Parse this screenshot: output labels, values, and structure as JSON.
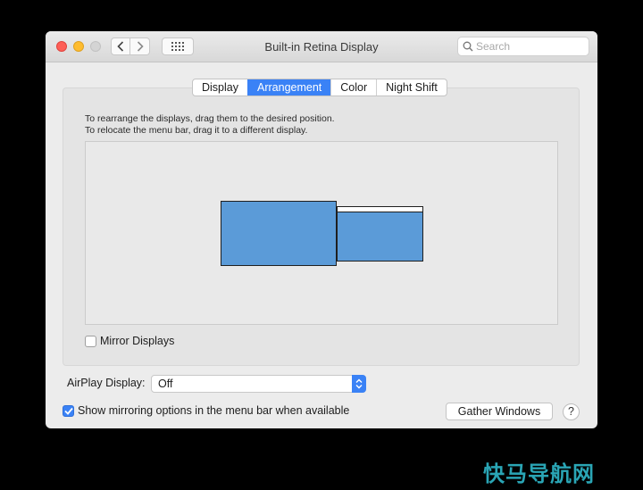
{
  "window": {
    "title": "Built-in Retina Display"
  },
  "search": {
    "placeholder": "Search"
  },
  "tabs": [
    {
      "label": "Display"
    },
    {
      "label": "Arrangement",
      "active": true
    },
    {
      "label": "Color"
    },
    {
      "label": "Night Shift"
    }
  ],
  "arrangement": {
    "instruction_1": "To rearrange the displays, drag them to the desired position.",
    "instruction_2": "To relocate the menu bar, drag it to a different display."
  },
  "mirror": {
    "label": "Mirror Displays",
    "checked": false
  },
  "airplay": {
    "label": "AirPlay Display:",
    "value": "Off"
  },
  "show_mirroring": {
    "label": "Show mirroring options in the menu bar when available",
    "checked": true
  },
  "gather": {
    "label": "Gather Windows"
  },
  "help": {
    "label": "?"
  },
  "watermark": {
    "text": "快马导航网"
  },
  "colors": {
    "accent": "#3a82f6",
    "display_fill": "#5b9bd8",
    "close": "#fe5f57",
    "minimize": "#febc2e"
  }
}
